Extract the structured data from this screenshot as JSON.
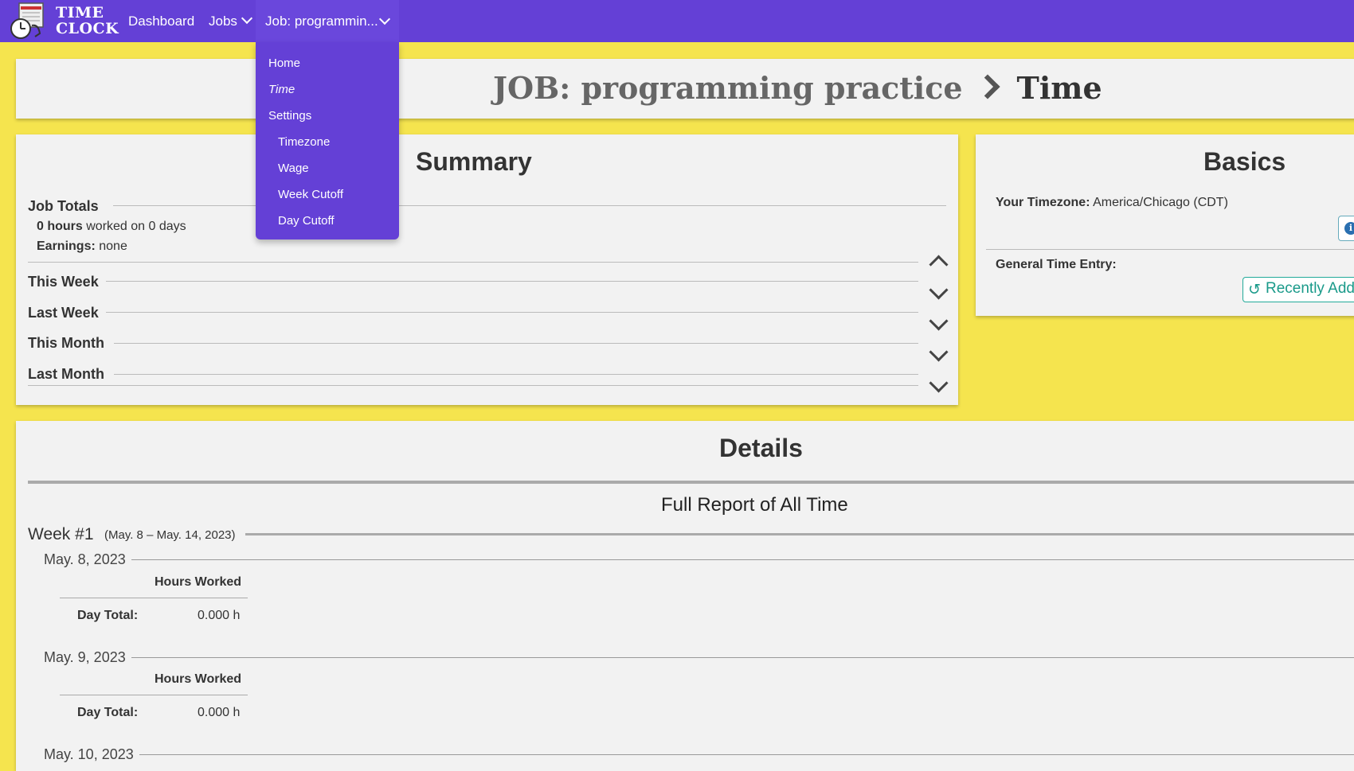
{
  "navbar": {
    "brand_line1": "TIME",
    "brand_line2": "CLOCK",
    "links": {
      "dashboard": "Dashboard",
      "jobs": "Jobs",
      "current_job": "Job: programmin..."
    }
  },
  "dropdown": {
    "home": "Home",
    "time": "Time",
    "settings": "Settings",
    "timezone": "Timezone",
    "wage": "Wage",
    "week_cutoff": "Week Cutoff",
    "day_cutoff": "Day Cutoff"
  },
  "page_title": {
    "job": "JOB: programming practice",
    "current": "Time"
  },
  "summary": {
    "heading": "Summary",
    "job_totals": {
      "label": "Job Totals",
      "hours_bold": "0 hours",
      "hours_rest": "worked on 0 days",
      "earnings_label": "Earnings:",
      "earnings_value": "none"
    },
    "sections": [
      "This Week",
      "Last Week",
      "This Month",
      "Last Month"
    ]
  },
  "basics": {
    "heading": "Basics",
    "timezone_label": "Your Timezone:",
    "timezone_value": "America/Chicago (CDT)",
    "info_icon": "i",
    "general_entry_label": "General Time Entry:",
    "recent_button": "Recently Added"
  },
  "details": {
    "heading": "Details",
    "report_title": "Full Report of All Time",
    "week_label": "Week #1",
    "week_range": "(May. 8 – May. 14, 2023)",
    "days": [
      {
        "date": "May. 8, 2023",
        "col_head": "Hours Worked",
        "row_label": "Day Total:",
        "value": "0.000 h"
      },
      {
        "date": "May. 9, 2023",
        "col_head": "Hours Worked",
        "row_label": "Day Total:",
        "value": "0.000 h"
      },
      {
        "date": "May. 10, 2023"
      }
    ]
  },
  "colors": {
    "navbar": "#6440d6",
    "background": "#f5e44e",
    "panel": "#f2f2f2",
    "accent_teal": "#1a9a8a"
  }
}
